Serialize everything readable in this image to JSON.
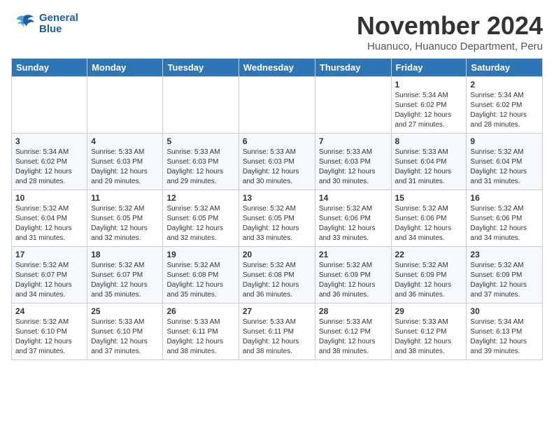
{
  "logo": {
    "text_general": "General",
    "text_blue": "Blue"
  },
  "title": "November 2024",
  "location": "Huanuco, Huanuco Department, Peru",
  "headers": [
    "Sunday",
    "Monday",
    "Tuesday",
    "Wednesday",
    "Thursday",
    "Friday",
    "Saturday"
  ],
  "weeks": [
    [
      {
        "day": "",
        "info": ""
      },
      {
        "day": "",
        "info": ""
      },
      {
        "day": "",
        "info": ""
      },
      {
        "day": "",
        "info": ""
      },
      {
        "day": "",
        "info": ""
      },
      {
        "day": "1",
        "info": "Sunrise: 5:34 AM\nSunset: 6:02 PM\nDaylight: 12 hours and 27 minutes."
      },
      {
        "day": "2",
        "info": "Sunrise: 5:34 AM\nSunset: 6:02 PM\nDaylight: 12 hours and 28 minutes."
      }
    ],
    [
      {
        "day": "3",
        "info": "Sunrise: 5:34 AM\nSunset: 6:02 PM\nDaylight: 12 hours and 28 minutes."
      },
      {
        "day": "4",
        "info": "Sunrise: 5:33 AM\nSunset: 6:03 PM\nDaylight: 12 hours and 29 minutes."
      },
      {
        "day": "5",
        "info": "Sunrise: 5:33 AM\nSunset: 6:03 PM\nDaylight: 12 hours and 29 minutes."
      },
      {
        "day": "6",
        "info": "Sunrise: 5:33 AM\nSunset: 6:03 PM\nDaylight: 12 hours and 30 minutes."
      },
      {
        "day": "7",
        "info": "Sunrise: 5:33 AM\nSunset: 6:03 PM\nDaylight: 12 hours and 30 minutes."
      },
      {
        "day": "8",
        "info": "Sunrise: 5:33 AM\nSunset: 6:04 PM\nDaylight: 12 hours and 31 minutes."
      },
      {
        "day": "9",
        "info": "Sunrise: 5:32 AM\nSunset: 6:04 PM\nDaylight: 12 hours and 31 minutes."
      }
    ],
    [
      {
        "day": "10",
        "info": "Sunrise: 5:32 AM\nSunset: 6:04 PM\nDaylight: 12 hours and 31 minutes."
      },
      {
        "day": "11",
        "info": "Sunrise: 5:32 AM\nSunset: 6:05 PM\nDaylight: 12 hours and 32 minutes."
      },
      {
        "day": "12",
        "info": "Sunrise: 5:32 AM\nSunset: 6:05 PM\nDaylight: 12 hours and 32 minutes."
      },
      {
        "day": "13",
        "info": "Sunrise: 5:32 AM\nSunset: 6:05 PM\nDaylight: 12 hours and 33 minutes."
      },
      {
        "day": "14",
        "info": "Sunrise: 5:32 AM\nSunset: 6:06 PM\nDaylight: 12 hours and 33 minutes."
      },
      {
        "day": "15",
        "info": "Sunrise: 5:32 AM\nSunset: 6:06 PM\nDaylight: 12 hours and 34 minutes."
      },
      {
        "day": "16",
        "info": "Sunrise: 5:32 AM\nSunset: 6:06 PM\nDaylight: 12 hours and 34 minutes."
      }
    ],
    [
      {
        "day": "17",
        "info": "Sunrise: 5:32 AM\nSunset: 6:07 PM\nDaylight: 12 hours and 34 minutes."
      },
      {
        "day": "18",
        "info": "Sunrise: 5:32 AM\nSunset: 6:07 PM\nDaylight: 12 hours and 35 minutes."
      },
      {
        "day": "19",
        "info": "Sunrise: 5:32 AM\nSunset: 6:08 PM\nDaylight: 12 hours and 35 minutes."
      },
      {
        "day": "20",
        "info": "Sunrise: 5:32 AM\nSunset: 6:08 PM\nDaylight: 12 hours and 36 minutes."
      },
      {
        "day": "21",
        "info": "Sunrise: 5:32 AM\nSunset: 6:09 PM\nDaylight: 12 hours and 36 minutes."
      },
      {
        "day": "22",
        "info": "Sunrise: 5:32 AM\nSunset: 6:09 PM\nDaylight: 12 hours and 36 minutes."
      },
      {
        "day": "23",
        "info": "Sunrise: 5:32 AM\nSunset: 6:09 PM\nDaylight: 12 hours and 37 minutes."
      }
    ],
    [
      {
        "day": "24",
        "info": "Sunrise: 5:32 AM\nSunset: 6:10 PM\nDaylight: 12 hours and 37 minutes."
      },
      {
        "day": "25",
        "info": "Sunrise: 5:33 AM\nSunset: 6:10 PM\nDaylight: 12 hours and 37 minutes."
      },
      {
        "day": "26",
        "info": "Sunrise: 5:33 AM\nSunset: 6:11 PM\nDaylight: 12 hours and 38 minutes."
      },
      {
        "day": "27",
        "info": "Sunrise: 5:33 AM\nSunset: 6:11 PM\nDaylight: 12 hours and 38 minutes."
      },
      {
        "day": "28",
        "info": "Sunrise: 5:33 AM\nSunset: 6:12 PM\nDaylight: 12 hours and 38 minutes."
      },
      {
        "day": "29",
        "info": "Sunrise: 5:33 AM\nSunset: 6:12 PM\nDaylight: 12 hours and 38 minutes."
      },
      {
        "day": "30",
        "info": "Sunrise: 5:34 AM\nSunset: 6:13 PM\nDaylight: 12 hours and 39 minutes."
      }
    ]
  ]
}
